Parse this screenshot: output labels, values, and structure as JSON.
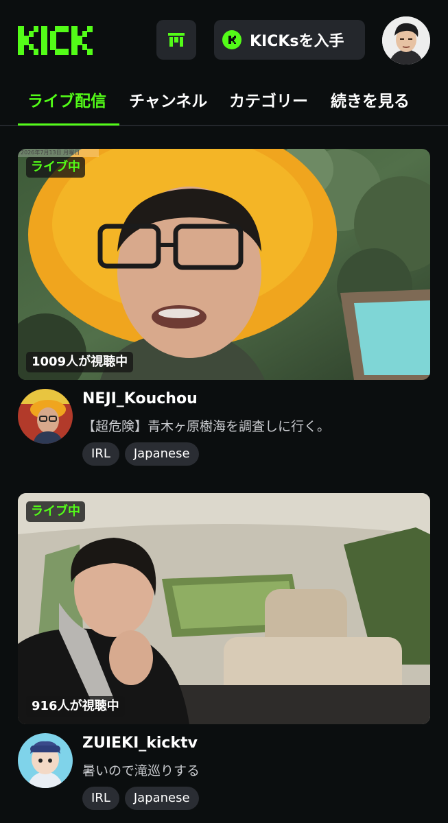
{
  "header": {
    "logo_text": "KICK",
    "store_icon": "store-icon",
    "kicks_label": "KICKsを入手",
    "accent": "#53fc18"
  },
  "tabs": [
    {
      "label": "ライブ配信",
      "active": true
    },
    {
      "label": "チャンネル",
      "active": false
    },
    {
      "label": "カテゴリー",
      "active": false
    },
    {
      "label": "続きを見る",
      "active": false
    }
  ],
  "streams": [
    {
      "live_label": "ライブ中",
      "viewers": "1009人が視聴中",
      "channel": "NEJI_Kouchou",
      "title": "【超危険】青木ヶ原樹海を調査しに行く。",
      "tags": [
        "IRL",
        "Japanese"
      ],
      "overlay_date": "2026年7月13日 月曜日"
    },
    {
      "live_label": "ライブ中",
      "viewers": "916人が視聴中",
      "channel": "ZUIEKI_kicktv",
      "title": "暑いので滝巡りする",
      "tags": [
        "IRL",
        "Japanese"
      ]
    }
  ]
}
